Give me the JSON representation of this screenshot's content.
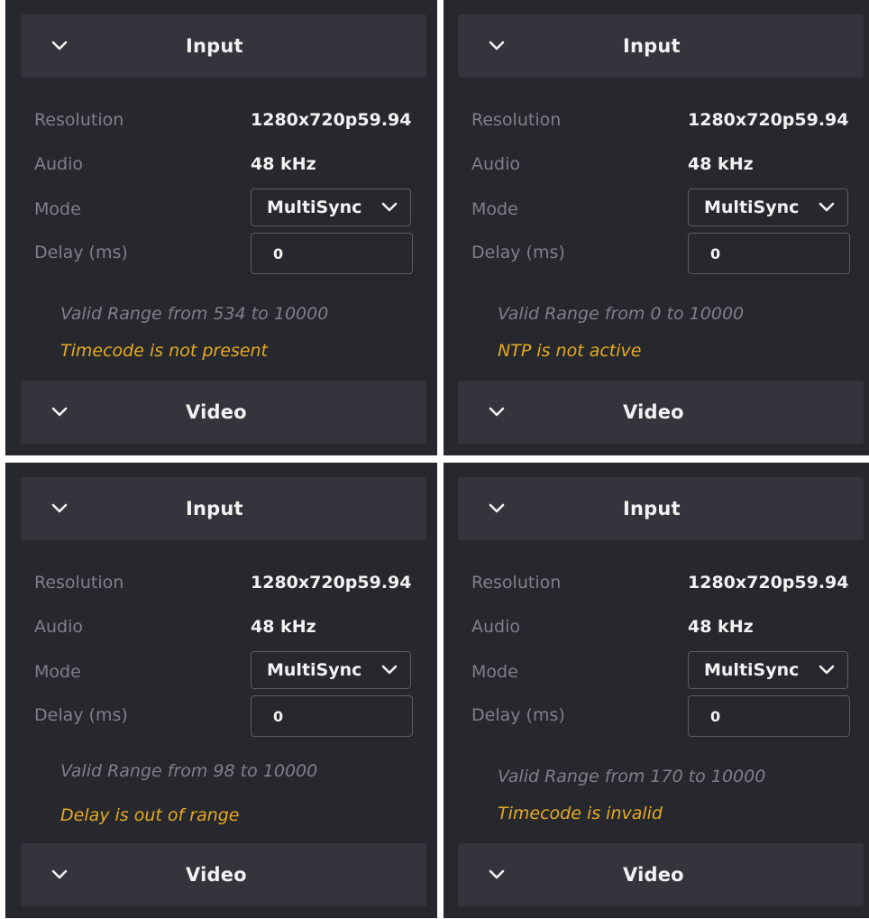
{
  "colors": {
    "panel_bg": "#27282d",
    "header_bg": "#34353c",
    "label": "#7e808a",
    "value": "#f2f2f2",
    "warning": "#e5aa20",
    "border": "#5a5c64"
  },
  "panels": [
    {
      "input_header": "Input",
      "resolution_label": "Resolution",
      "resolution_value": "1280x720p59.94",
      "audio_label": "Audio",
      "audio_value": "48 kHz",
      "mode_label": "Mode",
      "mode_value": "MultiSync",
      "delay_label": "Delay (ms)",
      "delay_value": "0",
      "range_note": "Valid Range from 534 to 10000",
      "warning": "Timecode is not present",
      "video_header": "Video"
    },
    {
      "input_header": "Input",
      "resolution_label": "Resolution",
      "resolution_value": "1280x720p59.94",
      "audio_label": "Audio",
      "audio_value": "48 kHz",
      "mode_label": "Mode",
      "mode_value": "MultiSync",
      "delay_label": "Delay (ms)",
      "delay_value": "0",
      "range_note": "Valid Range from 0 to 10000",
      "warning": "NTP is not active",
      "video_header": "Video"
    },
    {
      "input_header": "Input",
      "resolution_label": "Resolution",
      "resolution_value": "1280x720p59.94",
      "audio_label": "Audio",
      "audio_value": "48 kHz",
      "mode_label": "Mode",
      "mode_value": "MultiSync",
      "delay_label": "Delay (ms)",
      "delay_value": "0",
      "range_note": "Valid Range from 98 to 10000",
      "warning": "Delay is out of range",
      "video_header": "Video"
    },
    {
      "input_header": "Input",
      "resolution_label": "Resolution",
      "resolution_value": "1280x720p59.94",
      "audio_label": "Audio",
      "audio_value": "48 kHz",
      "mode_label": "Mode",
      "mode_value": "MultiSync",
      "delay_label": "Delay (ms)",
      "delay_value": "0",
      "range_note": "Valid Range from 170 to 10000",
      "warning": "Timecode is invalid",
      "video_header": "Video"
    }
  ]
}
